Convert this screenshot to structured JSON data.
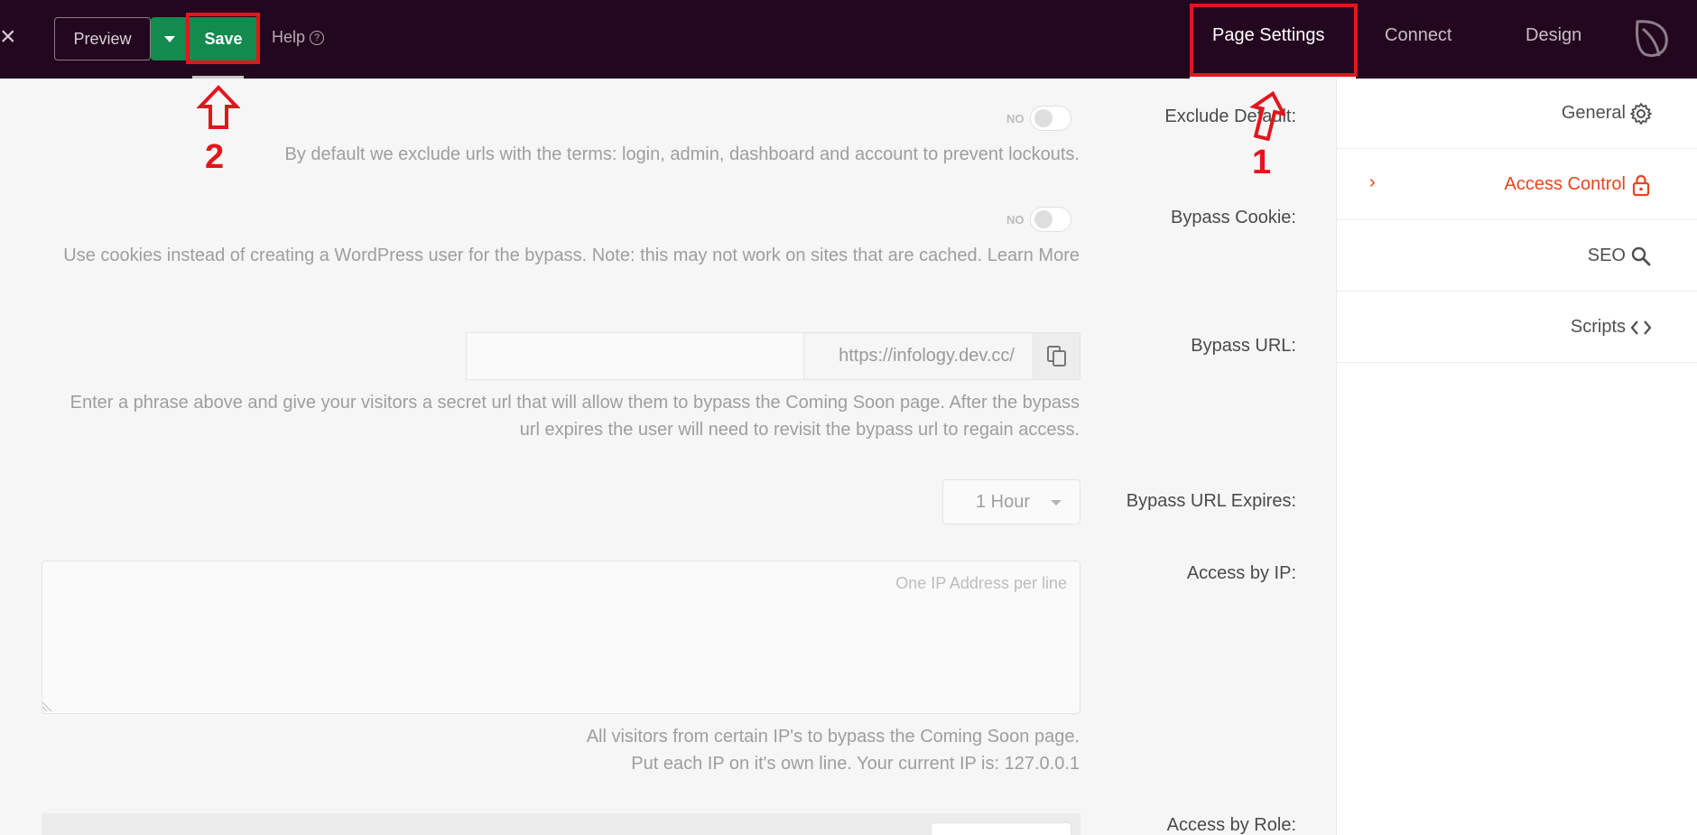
{
  "topbar": {
    "close_glyph": "×",
    "preview_label": "Preview",
    "save_label": "Save",
    "help_label": "Help",
    "help_icon_glyph": "?",
    "tabs": [
      {
        "label": "Page Settings",
        "active": true
      },
      {
        "label": "Connect",
        "active": false
      },
      {
        "label": "Design",
        "active": false
      }
    ],
    "logo_icon": "seedprod-leaf-icon",
    "accent_color": "#138a4e",
    "bar_color": "#23071f"
  },
  "annotations": {
    "number_1": "1",
    "number_2": "2",
    "color": "#e2161d"
  },
  "sidebar": {
    "items": [
      {
        "label": "General",
        "icon": "gear-icon",
        "active": false
      },
      {
        "label": "Access Control",
        "icon": "lock-icon",
        "active": true
      },
      {
        "label": "SEO",
        "icon": "search-icon",
        "active": false
      },
      {
        "label": "Scripts",
        "icon": "code-icon",
        "active": false
      }
    ],
    "active_color": "#e8441e"
  },
  "form": {
    "exclude_default": {
      "label": "Exclude Default:",
      "toggle_text": "NO",
      "help": "By default we exclude urls with the terms: login, admin, dashboard and account to prevent lockouts."
    },
    "bypass_cookie": {
      "label": "Bypass Cookie:",
      "toggle_text": "NO",
      "help": "Use cookies instead of creating a WordPress user for the bypass. Note: this may not work on sites that are cached. Learn More"
    },
    "bypass_url": {
      "label": "Bypass URL:",
      "value": "",
      "prefix": "https://infology.dev.cc/",
      "help": "Enter a phrase above and give your visitors a secret url that will allow them to bypass the Coming Soon page. After the bypass url expires the user will need to revisit the bypass url to regain access."
    },
    "bypass_url_expires": {
      "label": "Bypass URL Expires:",
      "value": "1 Hour"
    },
    "access_by_ip": {
      "label": "Access by IP:",
      "placeholder": "One IP Address per line",
      "help_line1": "All visitors from certain IP's to bypass the Coming Soon page.",
      "help_line2": "Put each IP on it's own line. Your current IP is: 127.0.0.1"
    },
    "access_by_role": {
      "label": "Access by Role:"
    }
  }
}
